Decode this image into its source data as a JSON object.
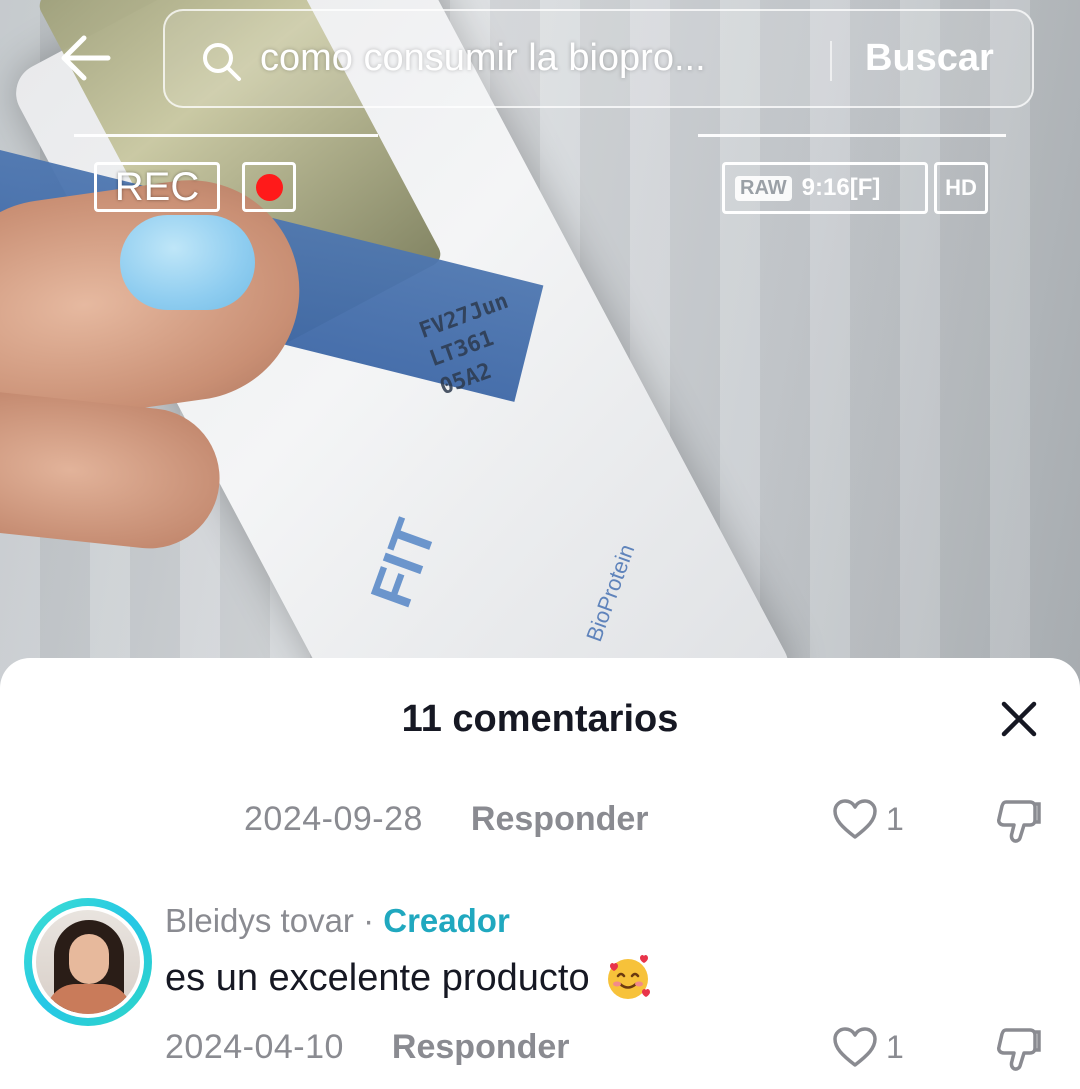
{
  "search": {
    "query": "como consumir la biopro...",
    "button_label": "Buscar"
  },
  "video": {
    "rec_label": "REC",
    "raw_label": "RAW",
    "ratio_label": "9:16[F]",
    "quality_label": "HD",
    "packet_print": [
      "FV27Jun",
      "LT361",
      "05A2"
    ],
    "packet_brand": "FIT",
    "packet_product": "BioProtein"
  },
  "comments": {
    "title": "11 comentarios",
    "items": [
      {
        "date": "2024-09-28",
        "reply_label": "Responder",
        "likes": "1"
      },
      {
        "author": "Bleidys tovar",
        "separator": " · ",
        "badge": "Creador",
        "text": "es un excelente producto",
        "date": "2024-04-10",
        "reply_label": "Responder",
        "likes": "1"
      }
    ]
  },
  "colors": {
    "creator_badge": "#20a8bf",
    "avatar_ring": "#25c7e6",
    "rec_dot": "#ff1a1a",
    "muted_text": "#8a8b91",
    "primary_text": "#161823"
  },
  "icons": [
    "back-arrow-icon",
    "search-icon",
    "close-icon",
    "heart-icon",
    "dislike-icon",
    "smiling-face-with-hearts-emoji"
  ]
}
